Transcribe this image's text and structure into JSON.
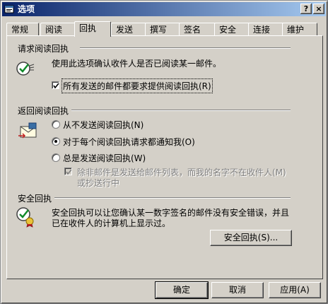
{
  "window": {
    "title": "选项",
    "help_label": "?",
    "close_label": "×"
  },
  "tabs": [
    "常规",
    "阅读",
    "回执",
    "发送",
    "撰写",
    "签名",
    "安全",
    "连接",
    "维护"
  ],
  "read_request": {
    "title": "请求阅读回执",
    "description": "使用此选项确认收件人是否已阅读某一邮件。",
    "checkbox_label": "所有发送的邮件都要求提供阅读回执(R)",
    "checked": true
  },
  "return_receipt": {
    "title": "返回阅读回执",
    "option_never": "从不发送阅读回执(N)",
    "option_notify": "对于每个阅读回执请求都通知我(O)",
    "option_always": "总是发送阅读回执(W)",
    "selected": "notify",
    "exception_line1": "除非邮件是发送给邮件列表，而我的名字不在收件人(M)",
    "exception_line2": "或抄送行中",
    "exception_checked": true
  },
  "secure_receipt": {
    "title": "安全回执",
    "description_line1": "安全回执可以让您确认某一数字签名的邮件没有安全错误，并且",
    "description_line2": "已在收件人的计算机上显示过。",
    "button_label": "安全回执(S)..."
  },
  "footer": {
    "ok_label": "确定",
    "cancel_label": "取消",
    "apply_label": "应用(A)"
  }
}
